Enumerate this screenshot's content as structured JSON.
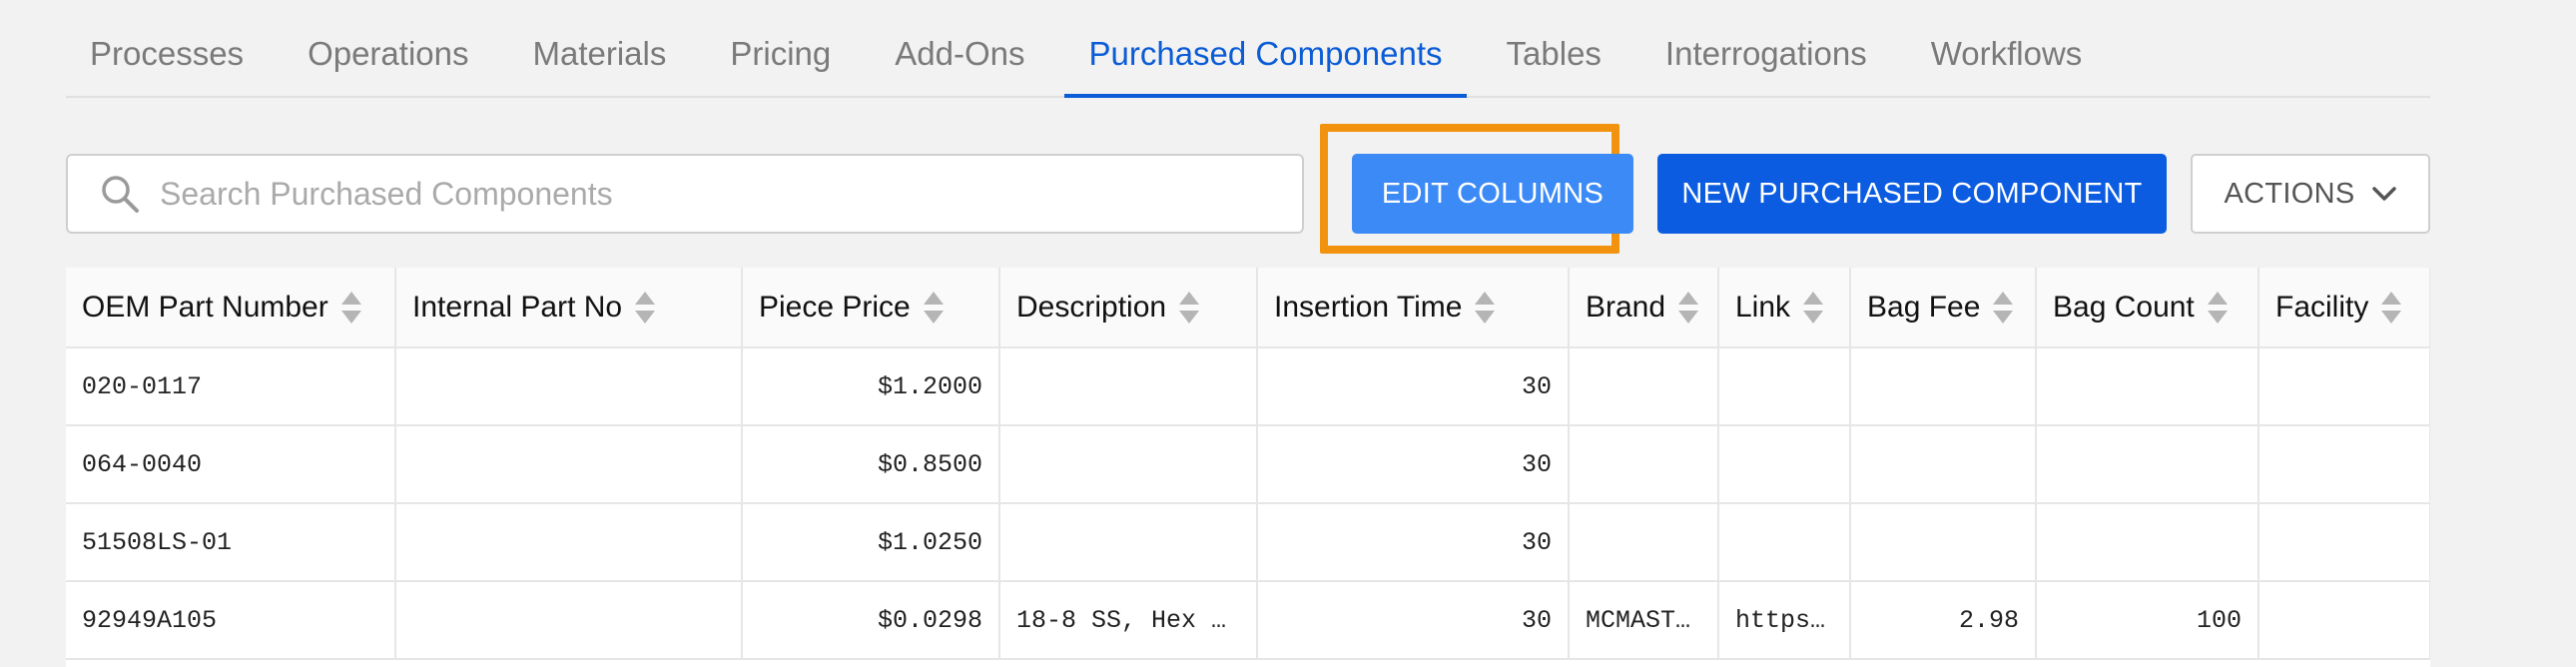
{
  "tabs": [
    {
      "label": "Processes",
      "active": false
    },
    {
      "label": "Operations",
      "active": false
    },
    {
      "label": "Materials",
      "active": false
    },
    {
      "label": "Pricing",
      "active": false
    },
    {
      "label": "Add-Ons",
      "active": false
    },
    {
      "label": "Purchased Components",
      "active": true
    },
    {
      "label": "Tables",
      "active": false
    },
    {
      "label": "Interrogations",
      "active": false
    },
    {
      "label": "Workflows",
      "active": false
    }
  ],
  "toolbar": {
    "search_placeholder": "Search Purchased Components",
    "search_value": "",
    "edit_columns_label": "EDIT COLUMNS",
    "new_component_label": "NEW PURCHASED COMPONENT",
    "actions_label": "ACTIONS"
  },
  "colors": {
    "accent": "#0b5cd6",
    "edit_button": "#3b8af6",
    "primary_button": "#0b5ce1",
    "highlight": "#f2930f"
  },
  "icons": {
    "search": "search-icon",
    "sort": "sort-icon",
    "actions_dropdown": "chevron-down-icon"
  },
  "table": {
    "columns": [
      "OEM Part Number",
      "Internal Part No",
      "Piece Price",
      "Description",
      "Insertion Time",
      "Brand",
      "Link",
      "Bag Fee",
      "Bag Count",
      "Facility"
    ],
    "rows": [
      [
        "020-0117",
        "",
        "$1.2000",
        "",
        "30",
        "",
        "",
        "",
        "",
        ""
      ],
      [
        "064-0040",
        "",
        "$0.8500",
        "",
        "30",
        "",
        "",
        "",
        "",
        ""
      ],
      [
        "51508LS-01",
        "",
        "$1.0250",
        "",
        "30",
        "",
        "",
        "",
        "",
        ""
      ],
      [
        "92949A105",
        "",
        "$0.0298",
        "18-8 SS, Hex S…",
        "30",
        "MCMASTER",
        "https…",
        "2.98",
        "100",
        ""
      ]
    ]
  }
}
